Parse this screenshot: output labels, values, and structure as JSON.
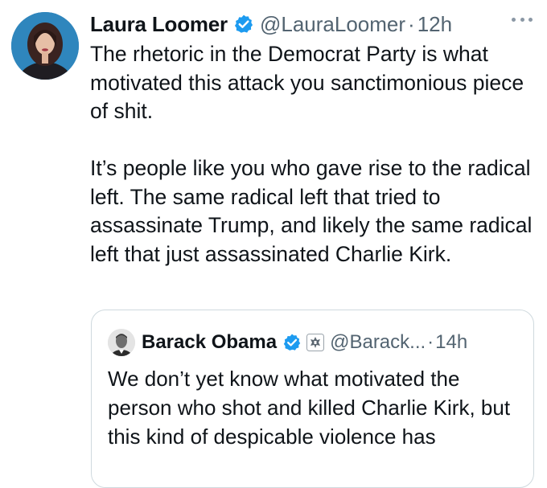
{
  "tweet": {
    "author": {
      "name": "Laura Loomer",
      "handle": "@LauraLoomer",
      "separator": "·",
      "time": "12h",
      "avatar_icon": "profile-photo",
      "verified_icon": "verified-badge-icon"
    },
    "paragraphs": [
      "The rhetoric in the Democrat Party is what motivated this attack you sanctimonious piece of shit.",
      "It’s people like you who gave rise to the radical left. The same radical left that tried to assassinate Trump, and likely the same radical left that just assassinated Charlie Kirk."
    ],
    "more_icon": "more-options-icon"
  },
  "quoted_tweet": {
    "author": {
      "name": "Barack Obama",
      "handle": "@Barack...",
      "separator": "·",
      "time": "14h",
      "avatar_icon": "profile-photo",
      "verified_icon": "verified-badge-icon",
      "affiliation_icon": "government-seal-icon"
    },
    "text": "We don’t yet know what motivated the person who shot and killed Charlie Kirk, but this kind of despicable violence has"
  },
  "colors": {
    "text": "#0f1419",
    "secondary": "#536471",
    "verified_blue": "#1d9bf0",
    "border": "#cfd9de"
  }
}
